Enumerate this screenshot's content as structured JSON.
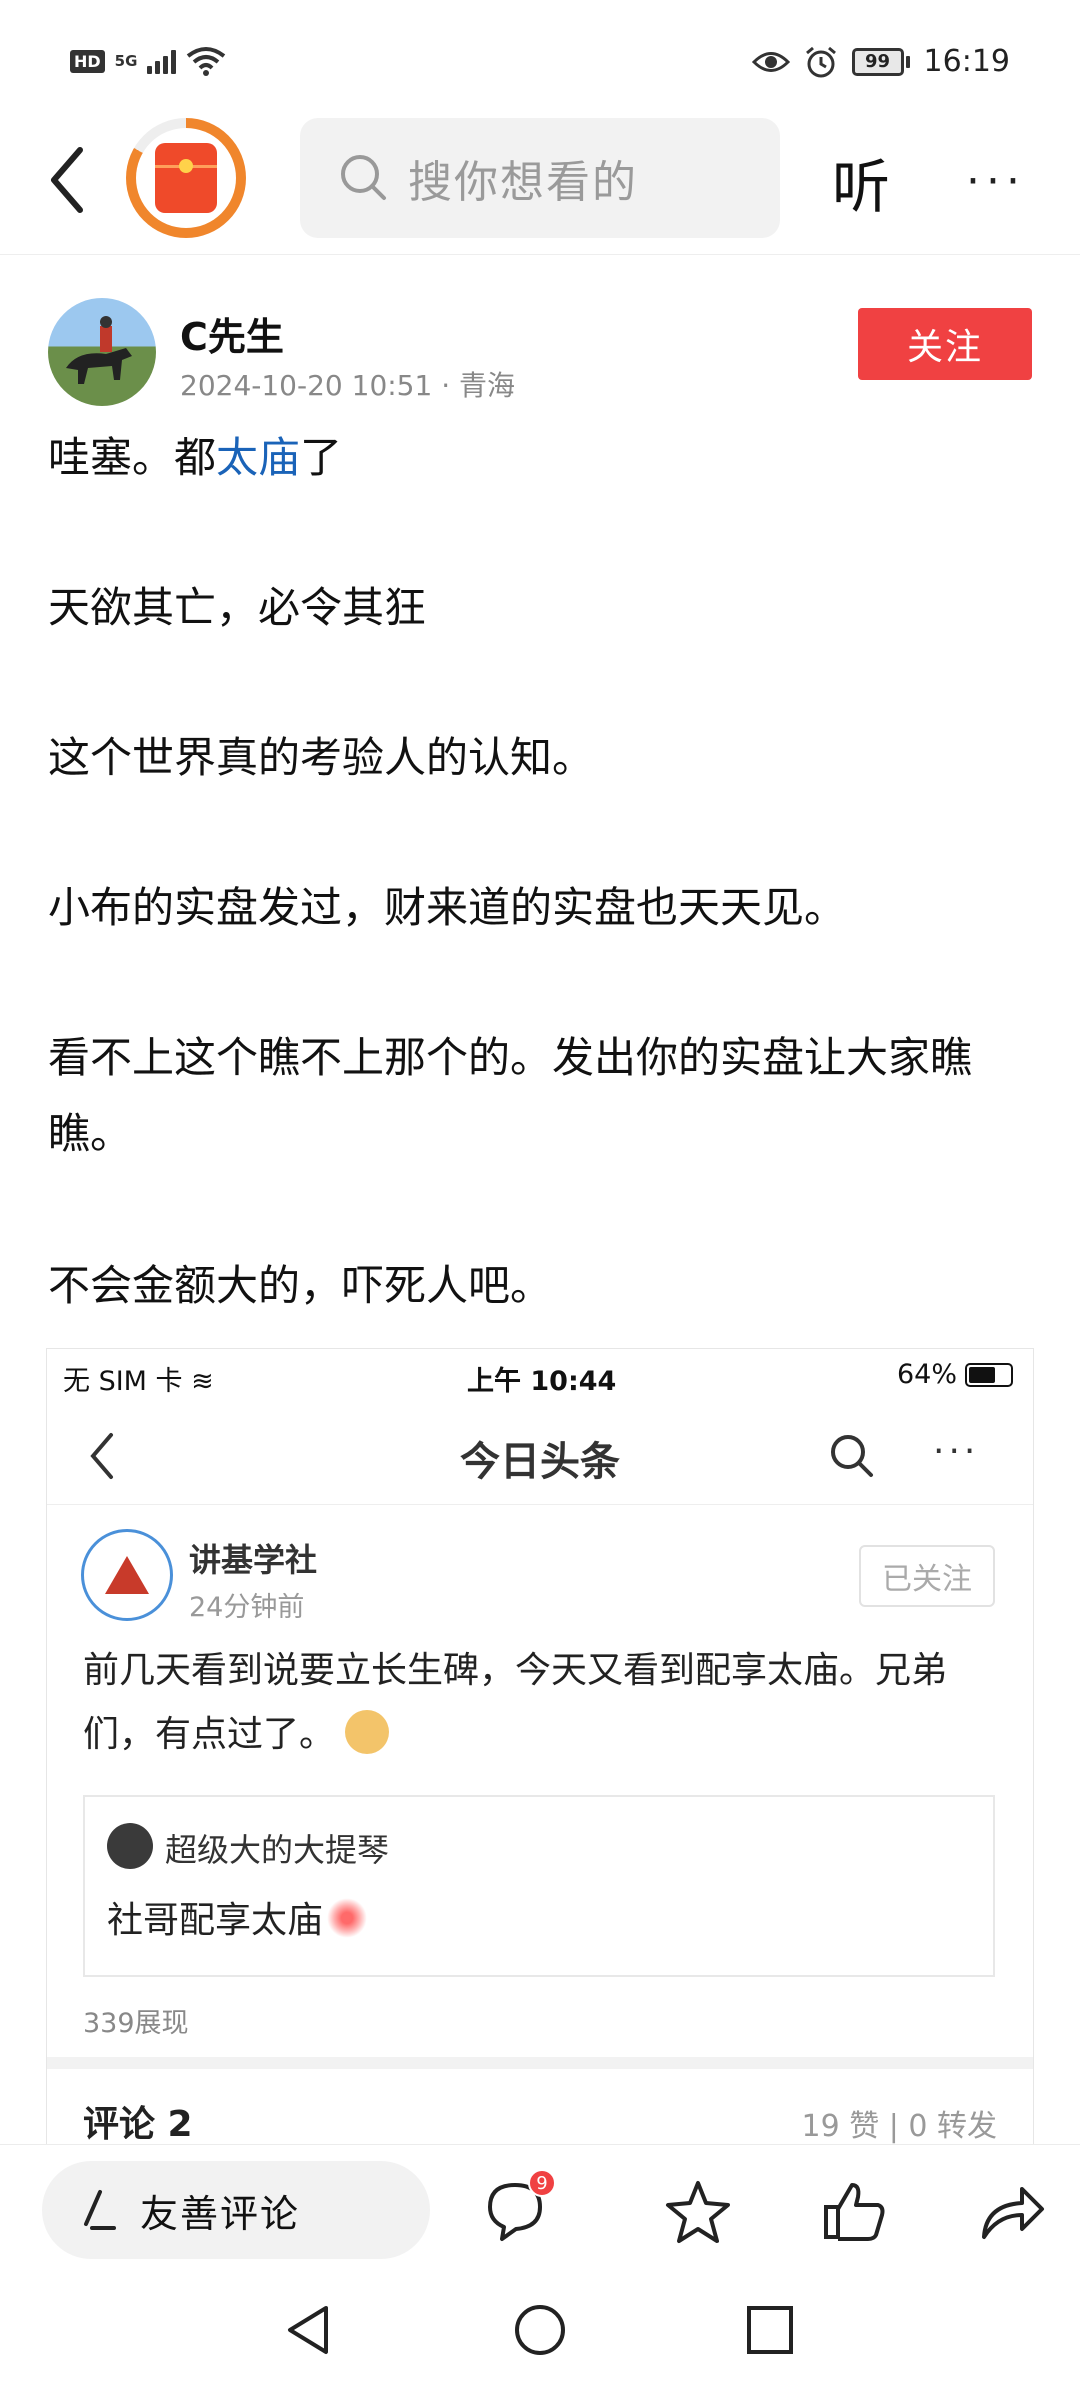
{
  "status_bar": {
    "hd": "HD",
    "network": "5G",
    "time": "16:19",
    "battery": "99"
  },
  "top_nav": {
    "search_placeholder": "搜你想看的",
    "listen_label": "听",
    "more_label": "···"
  },
  "author": {
    "name": "C先生",
    "meta": "2024-10-20 10:51 · 青海",
    "follow_label": "关注"
  },
  "post": {
    "p1_prefix": "哇塞。都",
    "p1_link": "太庙",
    "p1_suffix": "了",
    "p2": "天欲其亡，必令其狂",
    "p3": "这个世界真的考验人的认知。",
    "p4": "小布的实盘发过，财来道的实盘也天天见。",
    "p5": "看不上这个瞧不上那个的。发出你的实盘让大家瞧瞧。",
    "p6": "不会金额大的，吓死人吧。"
  },
  "embedded": {
    "carrier": "无 SIM 卡",
    "time": "上午 10:44",
    "battery": "64%",
    "app_title": "今日头条",
    "author_name": "讲基学社",
    "post_time": "24分钟前",
    "follow_state": "已关注",
    "content": "前几天看到说要立长生碑，今天又看到配享太庙。兄弟们，有点过了。",
    "quote_author": "超级大的大提琴",
    "quote_text": "社哥配享太庙",
    "views": "339展现",
    "comments": "评论 2",
    "stats": "19 赞 | 0 转发"
  },
  "action_bar": {
    "comment_placeholder": "友善评论",
    "comment_badge": "9"
  },
  "colors": {
    "follow": "#f04142",
    "link": "#1a63b8",
    "progress_ring": "#f0862c"
  }
}
